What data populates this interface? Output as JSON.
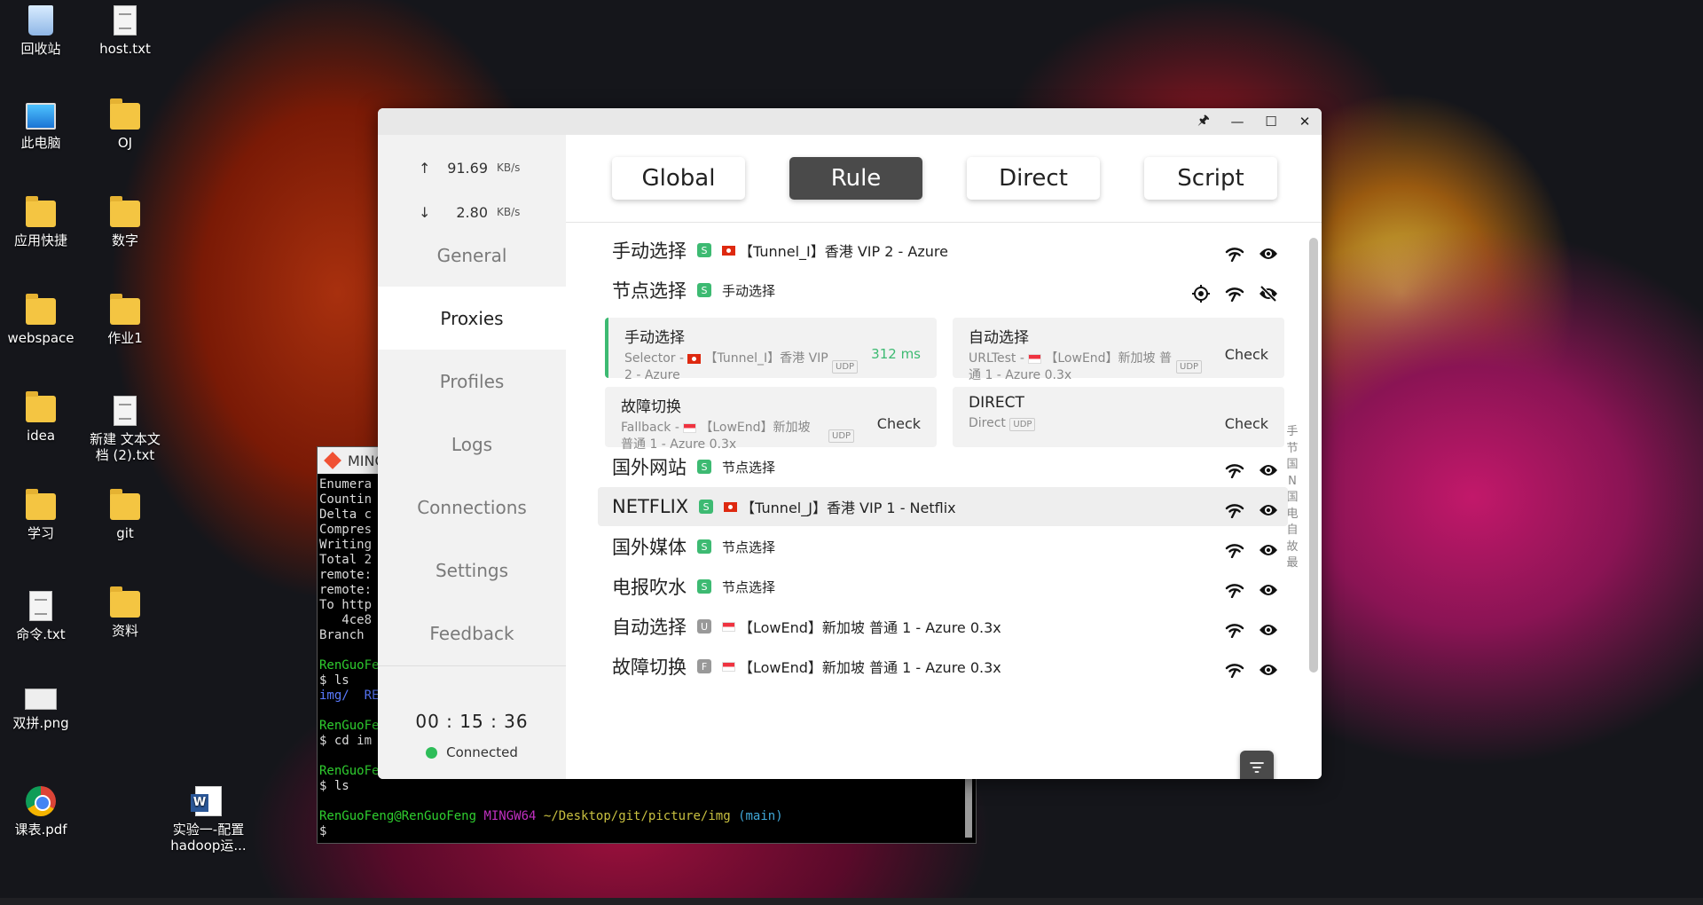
{
  "desktop": {
    "icons": [
      {
        "label": "回收站",
        "kind": "recycle"
      },
      {
        "label": "host.txt",
        "kind": "doc"
      },
      {
        "label": "此电脑",
        "kind": "monitor"
      },
      {
        "label": "OJ",
        "kind": "folder"
      },
      {
        "label": "应用快捷",
        "kind": "folder"
      },
      {
        "label": "数字",
        "kind": "folder"
      },
      {
        "label": "webspace",
        "kind": "folder"
      },
      {
        "label": "作业1",
        "kind": "folder"
      },
      {
        "label": "idea",
        "kind": "folder"
      },
      {
        "label": "新建 文本文档 (2).txt",
        "kind": "doc"
      },
      {
        "label": "学习",
        "kind": "folder"
      },
      {
        "label": "git",
        "kind": "folder"
      },
      {
        "label": "命令.txt",
        "kind": "doc"
      },
      {
        "label": "资料",
        "kind": "folder"
      },
      {
        "label": "双拼.png",
        "kind": "png"
      },
      {
        "label": "课表.pdf",
        "kind": "chrome"
      },
      {
        "label": "实验一-配置hadoop运...",
        "kind": "word"
      }
    ]
  },
  "terminal": {
    "title": "MING",
    "lines": [
      {
        "text": "Enumera",
        "color": ""
      },
      {
        "text": "Countin",
        "color": ""
      },
      {
        "text": "Delta c",
        "color": ""
      },
      {
        "text": "Compres",
        "color": ""
      },
      {
        "text": "Writing",
        "color": ""
      },
      {
        "text": "Total 2",
        "color": ""
      },
      {
        "text": "remote:",
        "color": ""
      },
      {
        "text": "remote:",
        "color": ""
      },
      {
        "text": "To http",
        "color": ""
      },
      {
        "text": "   4ce8",
        "color": ""
      },
      {
        "text": "Branch ",
        "color": ""
      },
      {
        "text": "",
        "color": ""
      },
      {
        "text": "RenGuoFe",
        "color": "t-green"
      },
      {
        "text": "$ ls",
        "color": ""
      },
      {
        "text": "img/  RE",
        "color": "t-blue"
      },
      {
        "text": "",
        "color": ""
      },
      {
        "text": "RenGuoFe",
        "color": "t-green"
      },
      {
        "text": "$ cd im",
        "color": ""
      },
      {
        "text": "",
        "color": ""
      },
      {
        "text": "RenGuoFe",
        "color": "t-green"
      },
      {
        "text": "$ ls",
        "color": ""
      },
      {
        "text": "",
        "color": ""
      }
    ],
    "prompt_user": "RenGuoFeng@RenGuoFeng",
    "prompt_env": "MINGW64",
    "prompt_path": "~/Desktop/git/picture/img",
    "prompt_branch": "(main)",
    "cursor_line": "$ "
  },
  "window": {
    "controls": {
      "pin": "🖈",
      "minimize": "—",
      "maximize": "☐",
      "close": "✕"
    },
    "traffic": {
      "up_arrow": "↑",
      "up_value": "91.69",
      "up_unit": "KB/s",
      "down_arrow": "↓",
      "down_value": "2.80",
      "down_unit": "KB/s"
    },
    "nav": [
      "General",
      "Proxies",
      "Profiles",
      "Logs",
      "Connections",
      "Settings",
      "Feedback"
    ],
    "active_nav": "Proxies",
    "timer": "00 : 15 : 36",
    "status": "Connected",
    "modes": [
      "Global",
      "Rule",
      "Direct",
      "Script"
    ],
    "active_mode": "Rule",
    "groups": [
      {
        "name": "手动选择",
        "badge": "S",
        "flag": "hk",
        "now": "【Tunnel_I】香港 VIP 2 - Azure"
      },
      {
        "name": "节点选择",
        "badge": "S",
        "flag": "",
        "now": "手动选择"
      },
      {
        "name": "国外网站",
        "badge": "S",
        "flag": "",
        "now": "节点选择"
      },
      {
        "name": "NETFLIX",
        "badge": "S",
        "flag": "hk",
        "now": "【Tunnel_J】香港 VIP 1 - Netflix"
      },
      {
        "name": "国外媒体",
        "badge": "S",
        "flag": "",
        "now": "节点选择"
      },
      {
        "name": "电报吹水",
        "badge": "S",
        "flag": "",
        "now": "节点选择"
      },
      {
        "name": "自动选择",
        "badge": "U",
        "flag": "sg",
        "now": "【LowEnd】新加坡 普通 1 - Azure 0.3x"
      },
      {
        "name": "故障切换",
        "badge": "F",
        "flag": "sg",
        "now": "【LowEnd】新加坡 普通 1 - Azure 0.3x"
      }
    ],
    "cards": [
      {
        "name": "手动选择",
        "type": "Selector -",
        "flag": "hk",
        "detail": "【Tunnel_I】香港 VIP 2 - Azure",
        "udp": "UDP",
        "right": "312 ms"
      },
      {
        "name": "自动选择",
        "type": "URLTest -",
        "flag": "sg",
        "detail": "【LowEnd】新加坡 普通 1 - Azure 0.3x",
        "udp": "UDP",
        "right": "Check"
      },
      {
        "name": "故障切换",
        "type": "Fallback -",
        "flag": "sg",
        "detail": "【LowEnd】新加坡 普通 1 - Azure 0.3x",
        "udp": "UDP",
        "right": "Check"
      },
      {
        "name": "DIRECT",
        "type": "Direct",
        "flag": "",
        "detail": "",
        "udp": "UDP",
        "right": "Check"
      }
    ],
    "side_index": [
      "手",
      "节",
      "国",
      "N",
      "国",
      "电",
      "自",
      "故",
      "最"
    ],
    "icons": {
      "test": "wifi-icon",
      "visible": "eye-icon",
      "hidden": "eye-off-icon",
      "locate": "locate-icon",
      "filter": "filter-icon"
    }
  }
}
